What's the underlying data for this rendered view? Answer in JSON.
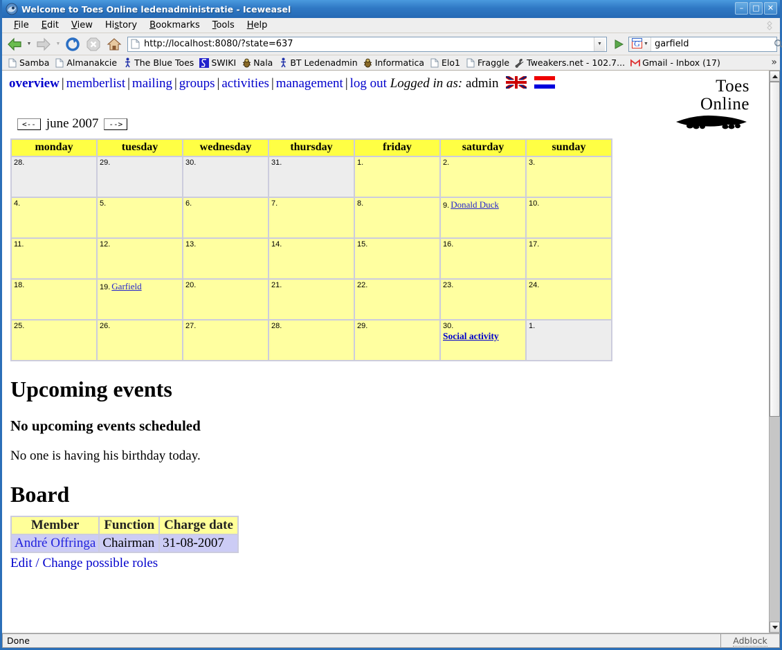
{
  "window": {
    "title": "Welcome to Toes Online ledenadministratie - Iceweasel",
    "minimize_label": "–",
    "maximize_label": "□",
    "close_label": "✕"
  },
  "menubar": {
    "items": [
      "File",
      "Edit",
      "View",
      "History",
      "Bookmarks",
      "Tools",
      "Help"
    ]
  },
  "toolbar": {
    "back_icon": "back-arrow-icon",
    "forward_icon": "forward-arrow-icon",
    "reload_icon": "reload-icon",
    "stop_icon": "stop-icon",
    "home_icon": "home-icon",
    "url": "http://localhost:8080/?state=637",
    "url_placeholder": "",
    "go_icon": "go-icon",
    "search_engine": "G",
    "search_value": "garfield",
    "search_placeholder": ""
  },
  "bookmarks": {
    "items": [
      {
        "label": "Samba",
        "icon": "page-icon"
      },
      {
        "label": "Almanakcie",
        "icon": "page-icon"
      },
      {
        "label": "The Blue Toes",
        "icon": "person-icon"
      },
      {
        "label": "SWIKI",
        "icon": "swiki-icon"
      },
      {
        "label": "Nala",
        "icon": "bug-icon"
      },
      {
        "label": "BT Ledenadmin",
        "icon": "person-icon"
      },
      {
        "label": "Informatica",
        "icon": "bug-icon"
      },
      {
        "label": "Elo1",
        "icon": "page-icon"
      },
      {
        "label": "Fraggle",
        "icon": "page-icon"
      },
      {
        "label": "Tweakers.net - 102.7...",
        "icon": "tweakers-icon"
      },
      {
        "label": "Gmail - Inbox (17)",
        "icon": "gmail-icon"
      }
    ],
    "overflow_label": "»"
  },
  "page": {
    "nav": {
      "overview": "overview",
      "memberlist": "memberlist",
      "mailing": "mailing",
      "groups": "groups",
      "activities": "activities",
      "management": "management",
      "logout": "log out",
      "logged_in_label": "Logged in as:",
      "username": "admin",
      "separator": "|",
      "flag_en": "uk-flag-icon",
      "flag_nl": "nl-flag-icon"
    },
    "logo": {
      "line1": "Toes",
      "line2": "Online"
    },
    "calendar": {
      "prev_label": "<--",
      "next_label": "-->",
      "month_label": "june 2007",
      "day_headers": [
        "monday",
        "tuesday",
        "wednesday",
        "thursday",
        "friday",
        "saturday",
        "sunday"
      ],
      "weeks": [
        [
          {
            "day": "28.",
            "other": true,
            "events": []
          },
          {
            "day": "29.",
            "other": true,
            "events": []
          },
          {
            "day": "30.",
            "other": true,
            "events": []
          },
          {
            "day": "31.",
            "other": true,
            "events": []
          },
          {
            "day": "1.",
            "other": false,
            "events": []
          },
          {
            "day": "2.",
            "other": false,
            "events": []
          },
          {
            "day": "3.",
            "other": false,
            "events": []
          }
        ],
        [
          {
            "day": "4.",
            "other": false,
            "events": []
          },
          {
            "day": "5.",
            "other": false,
            "events": []
          },
          {
            "day": "6.",
            "other": false,
            "events": []
          },
          {
            "day": "7.",
            "other": false,
            "events": []
          },
          {
            "day": "8.",
            "other": false,
            "events": []
          },
          {
            "day": "9.",
            "other": false,
            "events": [
              {
                "text": "Donald Duck",
                "style": "inline"
              }
            ]
          },
          {
            "day": "10.",
            "other": false,
            "events": []
          }
        ],
        [
          {
            "day": "11.",
            "other": false,
            "events": []
          },
          {
            "day": "12.",
            "other": false,
            "events": []
          },
          {
            "day": "13.",
            "other": false,
            "events": []
          },
          {
            "day": "14.",
            "other": false,
            "events": []
          },
          {
            "day": "15.",
            "other": false,
            "events": []
          },
          {
            "day": "16.",
            "other": false,
            "events": []
          },
          {
            "day": "17.",
            "other": false,
            "events": []
          }
        ],
        [
          {
            "day": "18.",
            "other": false,
            "events": []
          },
          {
            "day": "19.",
            "other": false,
            "events": [
              {
                "text": "Garfield",
                "style": "inline"
              }
            ]
          },
          {
            "day": "20.",
            "other": false,
            "events": []
          },
          {
            "day": "21.",
            "other": false,
            "events": []
          },
          {
            "day": "22.",
            "other": false,
            "events": []
          },
          {
            "day": "23.",
            "other": false,
            "events": []
          },
          {
            "day": "24.",
            "other": false,
            "events": []
          }
        ],
        [
          {
            "day": "25.",
            "other": false,
            "events": []
          },
          {
            "day": "26.",
            "other": false,
            "events": []
          },
          {
            "day": "27.",
            "other": false,
            "events": []
          },
          {
            "day": "28.",
            "other": false,
            "events": []
          },
          {
            "day": "29.",
            "other": false,
            "events": []
          },
          {
            "day": "30.",
            "other": false,
            "events": [
              {
                "text": "Social activity",
                "style": "block"
              }
            ]
          },
          {
            "day": "1.",
            "other": true,
            "events": []
          }
        ]
      ]
    },
    "upcoming": {
      "heading": "Upcoming events",
      "subheading": "No upcoming events scheduled",
      "birthday_text": "No one is having his birthday today."
    },
    "board": {
      "heading": "Board",
      "columns": [
        "Member",
        "Function",
        "Charge date"
      ],
      "rows": [
        {
          "member": "André Offringa",
          "function": "Chairman",
          "charge_date": "31-08-2007"
        }
      ],
      "edit_link": "Edit / Change possible roles"
    }
  },
  "statusbar": {
    "status": "Done",
    "adblock": "Adblock"
  },
  "colors": {
    "titlebar": "#2f78c4",
    "link": "#0000cc",
    "calendar_header": "#ffff44",
    "calendar_cell": "#ffffa0",
    "calendar_other": "#ededed",
    "board_header": "#ffff99",
    "board_cell": "#ccccf5"
  }
}
